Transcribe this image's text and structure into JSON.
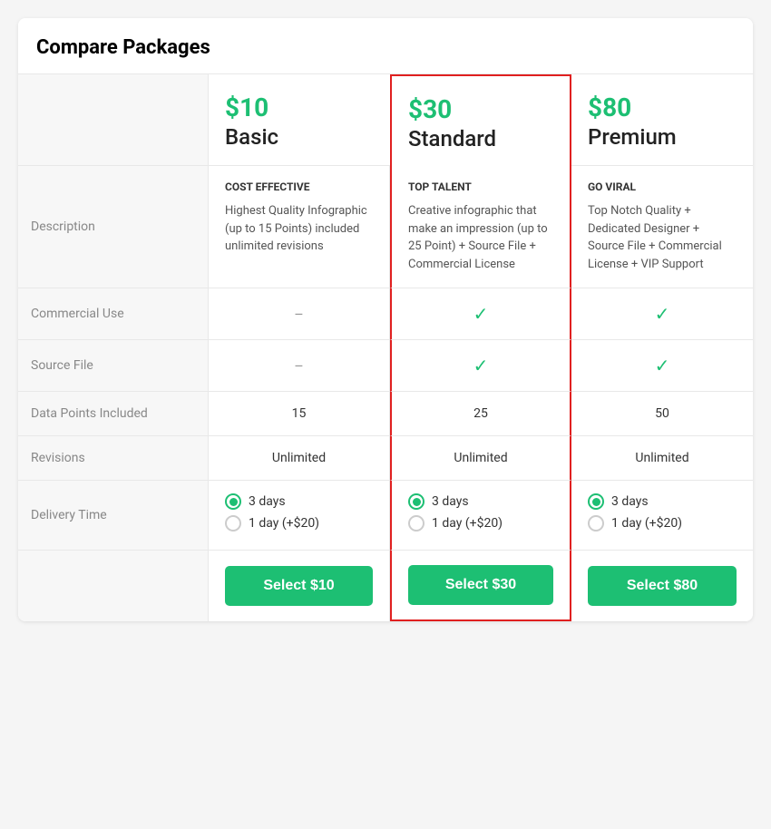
{
  "title": "Compare Packages",
  "packages": [
    {
      "id": "basic",
      "price": "$10",
      "name": "Basic",
      "highlighted": false,
      "description_subtitle": "COST EFFECTIVE",
      "description_text": "Highest Quality Infographic (up to 15 Points) included unlimited revisions",
      "commercial_use": false,
      "source_file": false,
      "data_points": "15",
      "revisions": "Unlimited",
      "delivery_3days": true,
      "delivery_1day": false,
      "delivery_label_3": "3 days",
      "delivery_label_1": "1 day (+$20)",
      "select_label": "Select $10"
    },
    {
      "id": "standard",
      "price": "$30",
      "name": "Standard",
      "highlighted": true,
      "description_subtitle": "TOP TALENT",
      "description_text": "Creative infographic that make an impression (up to 25 Point) + Source File + Commercial License",
      "commercial_use": true,
      "source_file": true,
      "data_points": "25",
      "revisions": "Unlimited",
      "delivery_3days": true,
      "delivery_1day": false,
      "delivery_label_3": "3 days",
      "delivery_label_1": "1 day (+$20)",
      "select_label": "Select $30"
    },
    {
      "id": "premium",
      "price": "$80",
      "name": "Premium",
      "highlighted": false,
      "description_subtitle": "GO VIRAL",
      "description_text": "Top Notch Quality + Dedicated Designer + Source File + Commercial License + VIP Support",
      "commercial_use": true,
      "source_file": true,
      "data_points": "50",
      "revisions": "Unlimited",
      "delivery_3days": true,
      "delivery_1day": false,
      "delivery_label_3": "3 days",
      "delivery_label_1": "1 day (+$20)",
      "select_label": "Select $80"
    }
  ],
  "row_labels": {
    "description": "Description",
    "commercial_use": "Commercial Use",
    "source_file": "Source File",
    "data_points": "Data Points Included",
    "revisions": "Revisions",
    "delivery_time": "Delivery Time"
  },
  "icons": {
    "check": "✓",
    "dash": "–"
  }
}
